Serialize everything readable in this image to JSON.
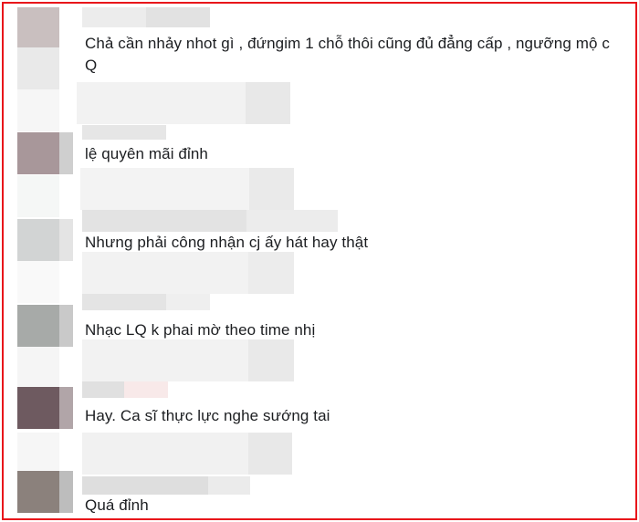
{
  "comments": [
    {
      "text": "Chả cần nhảy nhot gì , đứngim 1 chỗ thôi cũng đủ đẳng cấp , ngưỡng mộ c Q",
      "avatar_color": "#c9bfbf"
    },
    {
      "text": "lệ quyên mãi đỉnh",
      "avatar_color": "#a8979a"
    },
    {
      "text": "Nhưng phải công nhận cj ấy hát hay thật",
      "avatar_color": "#d2d4d4"
    },
    {
      "text": "Nhạc LQ k phai mờ theo time nhị",
      "avatar_color": "#a7aaa8"
    },
    {
      "text": "Hay. Ca sĩ thực lực nghe sướng tai",
      "avatar_color": "#6e5a60"
    },
    {
      "text": "Quá đỉnh",
      "avatar_color": "#8b817c"
    }
  ],
  "colors": {
    "frame_border": "#e8161b",
    "text": "#1c1e21"
  }
}
